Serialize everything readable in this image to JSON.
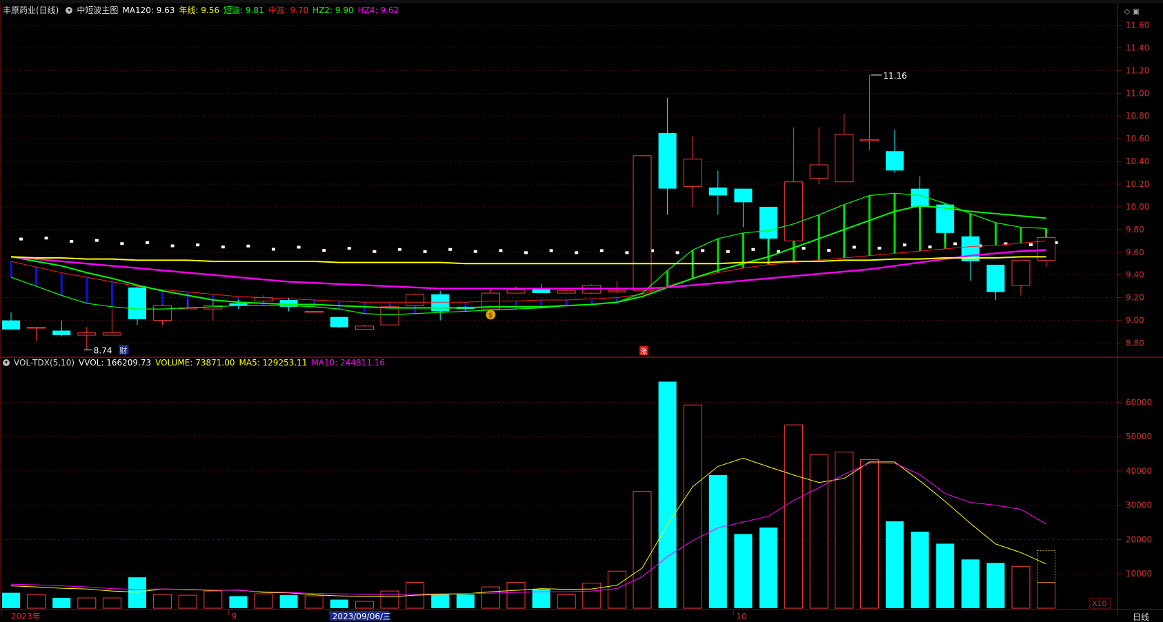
{
  "main_header": {
    "stock": "丰原药业(日线)",
    "indicator": "中短波主图",
    "items": [
      {
        "label": "MA120: 9.63",
        "color": "#ffffff"
      },
      {
        "label": "年线: 9.56",
        "color": "#ffff00"
      },
      {
        "label": "短波: 9.81",
        "color": "#00ff00"
      },
      {
        "label": "中波: 9.70",
        "color": "#ff2020"
      },
      {
        "label": "HZ2: 9.90",
        "color": "#00ff00"
      },
      {
        "label": "HZ4: 9.62",
        "color": "#ff00ff"
      }
    ]
  },
  "vol_header": {
    "indicator": "VOL-TDX(5,10)",
    "items": [
      {
        "label": "VVOL: 166209.73",
        "color": "#ffffff"
      },
      {
        "label": "VOLUME: 73871.00",
        "color": "#ffff00"
      },
      {
        "label": "MA5: 129253.11",
        "color": "#ffff00"
      },
      {
        "label": "MA10: 244811.16",
        "color": "#ff00ff"
      }
    ]
  },
  "labels": {
    "high": "11.16",
    "low": "8.74",
    "cai": "财",
    "zhang": "涨",
    "coin": "$",
    "x10": "X10",
    "period": "日线"
  },
  "chart_data": [
    {
      "type": "candlestick",
      "y_ticks": [
        "11.60",
        "11.40",
        "11.20",
        "11.00",
        "10.80",
        "10.60",
        "10.40",
        "10.20",
        "10.00",
        "9.80",
        "9.60",
        "9.40",
        "9.20",
        "9.00",
        "8.80"
      ],
      "ylim": [
        8.7,
        11.7
      ],
      "candles": [
        {
          "o": 9.0,
          "h": 9.07,
          "l": 8.92,
          "c": 8.92
        },
        {
          "o": 8.94,
          "h": 8.94,
          "l": 8.82,
          "c": 8.94
        },
        {
          "o": 8.91,
          "h": 9.0,
          "l": 8.86,
          "c": 8.87
        },
        {
          "o": 8.87,
          "h": 8.94,
          "l": 8.74,
          "c": 8.89
        },
        {
          "o": 8.87,
          "h": 9.1,
          "l": 8.87,
          "c": 8.89
        },
        {
          "o": 9.29,
          "h": 9.29,
          "l": 8.96,
          "c": 9.01
        },
        {
          "o": 9.0,
          "h": 9.14,
          "l": 8.96,
          "c": 9.13
        },
        {
          "o": 9.11,
          "h": 9.18,
          "l": 9.1,
          "c": 9.11
        },
        {
          "o": 9.1,
          "h": 9.18,
          "l": 9.0,
          "c": 9.13
        },
        {
          "o": 9.15,
          "h": 9.18,
          "l": 9.1,
          "c": 9.13
        },
        {
          "o": 9.17,
          "h": 9.22,
          "l": 9.16,
          "c": 9.2
        },
        {
          "o": 9.18,
          "h": 9.2,
          "l": 9.08,
          "c": 9.12
        },
        {
          "o": 9.08,
          "h": 9.08,
          "l": 9.08,
          "c": 9.08
        },
        {
          "o": 9.03,
          "h": 9.03,
          "l": 8.93,
          "c": 8.94
        },
        {
          "o": 8.92,
          "h": 8.96,
          "l": 8.92,
          "c": 8.95
        },
        {
          "o": 8.96,
          "h": 9.13,
          "l": 8.96,
          "c": 9.12
        },
        {
          "o": 9.13,
          "h": 9.24,
          "l": 9.13,
          "c": 9.23
        },
        {
          "o": 9.23,
          "h": 9.26,
          "l": 9.0,
          "c": 9.08
        },
        {
          "o": 9.12,
          "h": 9.12,
          "l": 9.08,
          "c": 9.1
        },
        {
          "o": 9.1,
          "h": 9.29,
          "l": 9.08,
          "c": 9.24
        },
        {
          "o": 9.24,
          "h": 9.3,
          "l": 9.24,
          "c": 9.27
        },
        {
          "o": 9.28,
          "h": 9.32,
          "l": 9.24,
          "c": 9.24
        },
        {
          "o": 9.24,
          "h": 9.27,
          "l": 9.24,
          "c": 9.26
        },
        {
          "o": 9.24,
          "h": 9.32,
          "l": 9.23,
          "c": 9.31
        },
        {
          "o": 9.25,
          "h": 9.35,
          "l": 9.24,
          "c": 9.26
        },
        {
          "o": 9.26,
          "h": 10.45,
          "l": 9.26,
          "c": 10.45
        },
        {
          "o": 10.65,
          "h": 10.96,
          "l": 9.93,
          "c": 10.16
        },
        {
          "o": 10.18,
          "h": 10.62,
          "l": 10.0,
          "c": 10.42
        },
        {
          "o": 10.17,
          "h": 10.32,
          "l": 9.93,
          "c": 10.1
        },
        {
          "o": 10.16,
          "h": 10.16,
          "l": 9.82,
          "c": 10.04
        },
        {
          "o": 10.0,
          "h": 10.0,
          "l": 9.62,
          "c": 9.72
        },
        {
          "o": 9.7,
          "h": 10.7,
          "l": 9.64,
          "c": 10.22
        },
        {
          "o": 10.25,
          "h": 10.7,
          "l": 10.2,
          "c": 10.37
        },
        {
          "o": 10.22,
          "h": 10.82,
          "l": 10.22,
          "c": 10.64
        },
        {
          "o": 10.59,
          "h": 11.16,
          "l": 10.5,
          "c": 10.59
        },
        {
          "o": 10.49,
          "h": 10.68,
          "l": 10.3,
          "c": 10.32
        },
        {
          "o": 10.16,
          "h": 10.27,
          "l": 9.95,
          "c": 10.0
        },
        {
          "o": 10.02,
          "h": 10.02,
          "l": 9.68,
          "c": 9.77
        },
        {
          "o": 9.74,
          "h": 9.75,
          "l": 9.35,
          "c": 9.52
        },
        {
          "o": 9.49,
          "h": 9.49,
          "l": 9.18,
          "c": 9.25
        },
        {
          "o": 9.31,
          "h": 9.53,
          "l": 9.22,
          "c": 9.53
        },
        {
          "o": 9.53,
          "h": 9.77,
          "l": 9.47,
          "c": 9.73
        }
      ],
      "lines": [
        {
          "key": "duanbo",
          "color": "#00ff00",
          "values": [
            9.38,
            9.3,
            9.22,
            9.15,
            9.12,
            9.1,
            9.1,
            9.11,
            9.12,
            9.13,
            9.13,
            9.13,
            9.12,
            9.1,
            9.06,
            9.05,
            9.06,
            9.07,
            9.08,
            9.09,
            9.1,
            9.11,
            9.13,
            9.14,
            9.16,
            9.24,
            9.44,
            9.62,
            9.72,
            9.77,
            9.79,
            9.85,
            9.93,
            10.02,
            10.1,
            10.12,
            10.1,
            10.03,
            9.94,
            9.86,
            9.82,
            9.81
          ]
        },
        {
          "key": "zhongbo",
          "color": "#ff2020",
          "values": [
            9.52,
            9.47,
            9.42,
            9.38,
            9.34,
            9.3,
            9.27,
            9.25,
            9.23,
            9.21,
            9.2,
            9.19,
            9.18,
            9.17,
            9.16,
            9.16,
            9.16,
            9.16,
            9.16,
            9.17,
            9.17,
            9.18,
            9.18,
            9.19,
            9.2,
            9.23,
            9.3,
            9.37,
            9.42,
            9.46,
            9.49,
            9.51,
            9.53,
            9.55,
            9.57,
            9.59,
            9.61,
            9.63,
            9.65,
            9.66,
            9.68,
            9.7
          ]
        },
        {
          "key": "hz2",
          "color": "#00ff00",
          "values": [
            9.56,
            9.52,
            9.48,
            9.42,
            9.37,
            9.31,
            9.26,
            9.22,
            9.18,
            9.16,
            9.15,
            9.14,
            9.14,
            9.13,
            9.12,
            9.11,
            9.11,
            9.11,
            9.11,
            9.12,
            9.12,
            9.12,
            9.13,
            9.14,
            9.16,
            9.21,
            9.29,
            9.37,
            9.44,
            9.5,
            9.56,
            9.64,
            9.72,
            9.8,
            9.88,
            9.96,
            10.01,
            9.99,
            9.96,
            9.94,
            9.92,
            9.9
          ]
        },
        {
          "key": "hz4",
          "color": "#ff00ff",
          "values": [
            9.56,
            9.54,
            9.52,
            9.5,
            9.48,
            9.46,
            9.44,
            9.42,
            9.4,
            9.38,
            9.36,
            9.34,
            9.33,
            9.32,
            9.31,
            9.3,
            9.29,
            9.28,
            9.28,
            9.28,
            9.28,
            9.28,
            9.28,
            9.28,
            9.28,
            9.28,
            9.29,
            9.31,
            9.33,
            9.35,
            9.37,
            9.39,
            9.41,
            9.43,
            9.45,
            9.48,
            9.51,
            9.54,
            9.57,
            9.59,
            9.61,
            9.62
          ]
        },
        {
          "key": "ma120",
          "color": "#ffffff",
          "values": [
            9.68,
            9.67,
            9.66,
            9.65,
            9.64,
            9.63,
            9.62,
            9.61,
            9.61,
            9.6,
            9.59,
            9.59,
            9.58,
            9.58,
            9.57,
            9.57,
            9.57,
            9.57,
            9.57,
            9.56,
            9.56,
            9.56,
            9.56,
            9.56,
            9.56,
            9.56,
            9.56,
            9.56,
            9.57,
            9.57,
            9.57,
            9.58,
            9.58,
            9.59,
            9.6,
            9.61,
            9.61,
            9.62,
            9.62,
            9.62,
            9.63,
            9.63
          ]
        },
        {
          "key": "nianxian",
          "color": "#ffff00",
          "values": [
            9.56,
            9.55,
            9.55,
            9.54,
            9.54,
            9.53,
            9.53,
            9.53,
            9.52,
            9.52,
            9.52,
            9.52,
            9.52,
            9.51,
            9.51,
            9.51,
            9.51,
            9.51,
            9.5,
            9.5,
            9.5,
            9.5,
            9.5,
            9.5,
            9.5,
            9.5,
            9.5,
            9.5,
            9.5,
            9.51,
            9.51,
            9.52,
            9.52,
            9.53,
            9.53,
            9.54,
            9.54,
            9.55,
            9.55,
            9.55,
            9.56,
            9.56
          ]
        }
      ]
    },
    {
      "type": "bar",
      "y_ticks": [
        "60000",
        "50000",
        "40000",
        "30000",
        "20000",
        "10000"
      ],
      "ylim": [
        0,
        69500
      ],
      "x_ticks": [
        {
          "i": 0,
          "label": "2023年"
        },
        {
          "i": 9,
          "label": "9"
        },
        {
          "i": 13,
          "label": "2023/09/06/三"
        },
        {
          "i": 29,
          "label": "10"
        }
      ],
      "volumes": [
        4500,
        4000,
        3000,
        3000,
        3000,
        9000,
        4000,
        3800,
        5000,
        3500,
        4200,
        3800,
        3600,
        2500,
        2000,
        5000,
        7500,
        4000,
        4000,
        6200,
        7500,
        5500,
        3900,
        7300,
        10800,
        34000,
        66000,
        59200,
        38800,
        21600,
        23500,
        53400,
        44800,
        45500,
        43300,
        25300,
        22300,
        18800,
        14200,
        13200,
        12200,
        7500
      ],
      "ma5": [
        6500,
        6200,
        5800,
        5600,
        5000,
        4700,
        5600,
        5400,
        5200,
        5300,
        4600,
        4500,
        3900,
        3600,
        3400,
        3300,
        3800,
        4000,
        4200,
        4800,
        5200,
        5700,
        5500,
        5600,
        6700,
        11700,
        24300,
        35400,
        41300,
        43700,
        41200,
        38800,
        36600,
        37800,
        42600,
        42600,
        37100,
        31100,
        24700,
        18700,
        16200,
        12900
      ],
      "ma10": [
        7000,
        6800,
        6500,
        6200,
        5700,
        5500,
        5600,
        5500,
        5300,
        5200,
        4800,
        4600,
        4300,
        4200,
        4000,
        4000,
        4100,
        4200,
        4300,
        4400,
        4600,
        4800,
        4800,
        5000,
        5700,
        9200,
        15000,
        19700,
        23400,
        25100,
        26800,
        31400,
        35100,
        39000,
        42300,
        42200,
        38900,
        33400,
        30800,
        30000,
        28800,
        24500
      ]
    }
  ]
}
